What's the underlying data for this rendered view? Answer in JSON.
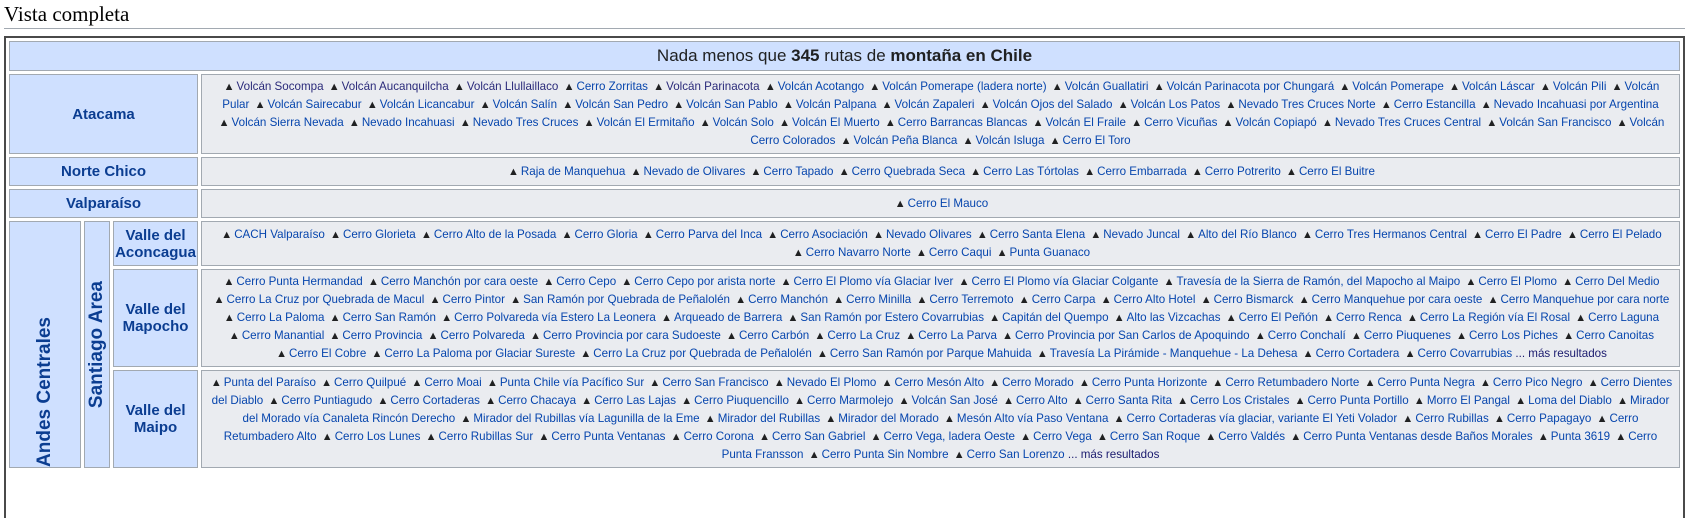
{
  "page": {
    "heading": "Vista completa"
  },
  "title": {
    "prefix": "Nada menos que ",
    "count": "345",
    "middle": " rutas de ",
    "bold": "montaña en Chile"
  },
  "marker": "▲",
  "more_label": "... más resultados",
  "atacama": {
    "label": "Atacama",
    "routes": [
      {
        "t": "Volcán Socompa",
        "v": true
      },
      {
        "t": "Volcán Aucanquilcha",
        "v": true
      },
      {
        "t": "Volcán Llullaillaco",
        "v": true
      },
      {
        "t": "Cerro Zorritas"
      },
      {
        "t": "Volcán Parinacota",
        "v": true
      },
      {
        "t": "Volcán Acotango"
      },
      {
        "t": "Volcán Pomerape (ladera norte)"
      },
      {
        "t": "Volcán Guallatiri"
      },
      {
        "t": "Volcán Parinacota por Chungará"
      },
      {
        "t": "Volcán Pomerape"
      },
      {
        "t": "Volcán Láscar"
      },
      {
        "t": "Volcán Pili"
      },
      {
        "t": "Volcán Pular"
      },
      {
        "t": "Volcán Sairecabur"
      },
      {
        "t": "Volcán Licancabur"
      },
      {
        "t": "Volcán Salín"
      },
      {
        "t": "Volcán San Pedro"
      },
      {
        "t": "Volcán San Pablo"
      },
      {
        "t": "Volcán Palpana"
      },
      {
        "t": "Volcán Zapaleri"
      },
      {
        "t": "Volcán Ojos del Salado"
      },
      {
        "t": "Volcán Los Patos"
      },
      {
        "t": "Nevado Tres Cruces Norte"
      },
      {
        "t": "Cerro Estancilla"
      },
      {
        "t": "Nevado Incahuasi por Argentina"
      },
      {
        "t": "Volcán Sierra Nevada"
      },
      {
        "t": "Nevado Incahuasi"
      },
      {
        "t": "Nevado Tres Cruces"
      },
      {
        "t": "Volcán El Ermitaño"
      },
      {
        "t": "Volcán Solo"
      },
      {
        "t": "Volcán El Muerto"
      },
      {
        "t": "Cerro Barrancas Blancas"
      },
      {
        "t": "Volcán El Fraile"
      },
      {
        "t": "Cerro Vicuñas"
      },
      {
        "t": "Volcán Copiapó"
      },
      {
        "t": "Nevado Tres Cruces Central"
      },
      {
        "t": "Volcán San Francisco"
      },
      {
        "t": "Volcán Cerro Colorados"
      },
      {
        "t": "Volcán Peña Blanca"
      },
      {
        "t": "Volcán Isluga"
      },
      {
        "t": "Cerro El Toro"
      }
    ]
  },
  "norte_chico": {
    "label": "Norte Chico",
    "routes": [
      {
        "t": "Raja de Manquehua"
      },
      {
        "t": "Nevado de Olivares"
      },
      {
        "t": "Cerro Tapado"
      },
      {
        "t": "Cerro Quebrada Seca"
      },
      {
        "t": "Cerro Las Tórtolas"
      },
      {
        "t": "Cerro Embarrada"
      },
      {
        "t": "Cerro Potrerito"
      },
      {
        "t": "Cerro El Buitre"
      }
    ]
  },
  "valparaiso": {
    "label": "Valparaíso",
    "routes": [
      {
        "t": "Cerro El Mauco"
      }
    ]
  },
  "central": {
    "label": "Andes Centrales",
    "santiago": {
      "label": "Santiago Area",
      "aconcagua": {
        "label": "Valle del Aconcagua",
        "routes": [
          {
            "t": "CACH Valparaíso"
          },
          {
            "t": "Cerro Glorieta"
          },
          {
            "t": "Cerro Alto de la Posada"
          },
          {
            "t": "Cerro Gloria"
          },
          {
            "t": "Cerro Parva del Inca"
          },
          {
            "t": "Cerro Asociación"
          },
          {
            "t": "Nevado Olivares"
          },
          {
            "t": "Cerro Santa Elena"
          },
          {
            "t": "Nevado Juncal"
          },
          {
            "t": "Alto del Río Blanco"
          },
          {
            "t": "Cerro Tres Hermanos Central"
          },
          {
            "t": "Cerro El Padre"
          },
          {
            "t": "Cerro El Pelado"
          },
          {
            "t": "Cerro Navarro Norte"
          },
          {
            "t": "Cerro Caqui"
          },
          {
            "t": "Punta Guanaco"
          }
        ]
      },
      "mapocho": {
        "label": "Valle del Mapocho",
        "routes": [
          {
            "t": "Cerro Punta Hermandad"
          },
          {
            "t": "Cerro Manchón por cara oeste"
          },
          {
            "t": "Cerro Cepo"
          },
          {
            "t": "Cerro Cepo por arista norte"
          },
          {
            "t": "Cerro El Plomo vía Glaciar Iver"
          },
          {
            "t": "Cerro El Plomo vía Glaciar Colgante"
          },
          {
            "t": "Travesía de la Sierra de Ramón, del Mapocho al Maipo"
          },
          {
            "t": "Cerro El Plomo"
          },
          {
            "t": "Cerro Del Medio"
          },
          {
            "t": "Cerro La Cruz por Quebrada de Macul"
          },
          {
            "t": "Cerro Pintor"
          },
          {
            "t": "San Ramón por Quebrada de Peñalolén"
          },
          {
            "t": "Cerro Manchón"
          },
          {
            "t": "Cerro Minilla"
          },
          {
            "t": "Cerro Terremoto"
          },
          {
            "t": "Cerro Carpa"
          },
          {
            "t": "Cerro Alto Hotel"
          },
          {
            "t": "Cerro Bismarck"
          },
          {
            "t": "Cerro Manquehue por cara oeste"
          },
          {
            "t": "Cerro Manquehue por cara norte"
          },
          {
            "t": "Cerro La Paloma"
          },
          {
            "t": "Cerro San Ramón"
          },
          {
            "t": "Cerro Polvareda vía Estero La Leonera"
          },
          {
            "t": "Arqueado de Barrera"
          },
          {
            "t": "San Ramón por Estero Covarrubias"
          },
          {
            "t": "Capitán del Quempo"
          },
          {
            "t": "Alto las Vizcachas"
          },
          {
            "t": "Cerro El Peñón"
          },
          {
            "t": "Cerro Renca"
          },
          {
            "t": "Cerro La Región vía El Rosal"
          },
          {
            "t": "Cerro Laguna"
          },
          {
            "t": "Cerro Manantial"
          },
          {
            "t": "Cerro Provincia"
          },
          {
            "t": "Cerro Polvareda"
          },
          {
            "t": "Cerro Provincia por cara Sudoeste"
          },
          {
            "t": "Cerro Carbón"
          },
          {
            "t": "Cerro La Cruz"
          },
          {
            "t": "Cerro La Parva"
          },
          {
            "t": "Cerro Provincia por San Carlos de Apoquindo"
          },
          {
            "t": "Cerro Conchalí"
          },
          {
            "t": "Cerro Piuquenes"
          },
          {
            "t": "Cerro Los Piches"
          },
          {
            "t": "Cerro Canoitas"
          },
          {
            "t": "Cerro El Cobre"
          },
          {
            "t": "Cerro La Paloma por Glaciar Sureste"
          },
          {
            "t": "Cerro La Cruz por Quebrada de Peñalolén"
          },
          {
            "t": "Cerro San Ramón por Parque Mahuida"
          },
          {
            "t": "Travesía La Pirámide - Manquehue - La Dehesa"
          },
          {
            "t": "Cerro Cortadera"
          },
          {
            "t": "Cerro Covarrubias"
          }
        ],
        "more": true
      },
      "maipo": {
        "label": "Valle del Maipo",
        "routes": [
          {
            "t": "Punta del Paraíso"
          },
          {
            "t": "Cerro Quilpué"
          },
          {
            "t": "Cerro Moai"
          },
          {
            "t": "Punta Chile vía Pacífico Sur"
          },
          {
            "t": "Cerro San Francisco"
          },
          {
            "t": "Nevado El Plomo"
          },
          {
            "t": "Cerro Mesón Alto"
          },
          {
            "t": "Cerro Morado"
          },
          {
            "t": "Cerro Punta Horizonte"
          },
          {
            "t": "Cerro Retumbadero Norte"
          },
          {
            "t": "Cerro Punta Negra"
          },
          {
            "t": "Cerro Pico Negro"
          },
          {
            "t": "Cerro Dientes del Diablo"
          },
          {
            "t": "Cerro Puntiagudo"
          },
          {
            "t": "Cerro Cortaderas"
          },
          {
            "t": "Cerro Chacaya"
          },
          {
            "t": "Cerro Las Lajas"
          },
          {
            "t": "Cerro Piuquencillo"
          },
          {
            "t": "Cerro Marmolejo"
          },
          {
            "t": "Volcán San José"
          },
          {
            "t": "Cerro Alto"
          },
          {
            "t": "Cerro Santa Rita"
          },
          {
            "t": "Cerro Los Cristales"
          },
          {
            "t": "Cerro Punta Portillo"
          },
          {
            "t": "Morro El Pangal"
          },
          {
            "t": "Loma del Diablo"
          },
          {
            "t": "Mirador del Morado vía Canaleta Rincón Derecho"
          },
          {
            "t": "Mirador del Rubillas vía Lagunilla de la Eme"
          },
          {
            "t": "Mirador del Rubillas"
          },
          {
            "t": "Mirador del Morado"
          },
          {
            "t": "Mesón Alto vía Paso Ventana"
          },
          {
            "t": "Cerro Cortaderas vía glaciar, variante El Yeti Volador"
          },
          {
            "t": "Cerro Rubillas"
          },
          {
            "t": "Cerro Papagayo"
          },
          {
            "t": "Cerro Retumbadero Alto"
          },
          {
            "t": "Cerro Los Lunes"
          },
          {
            "t": "Cerro Rubillas Sur"
          },
          {
            "t": "Cerro Punta Ventanas"
          },
          {
            "t": "Cerro Corona"
          },
          {
            "t": "Cerro San Gabriel"
          },
          {
            "t": "Cerro Vega, ladera Oeste"
          },
          {
            "t": "Cerro Vega"
          },
          {
            "t": "Cerro San Roque"
          },
          {
            "t": "Cerro Valdés"
          },
          {
            "t": "Cerro Punta Ventanas desde Baños Morales"
          },
          {
            "t": "Punta 3619"
          },
          {
            "t": "Cerro Punta Fransson"
          },
          {
            "t": "Cerro Punta Sin Nombre"
          },
          {
            "t": "Cerro San Lorenzo"
          }
        ],
        "more": true
      }
    }
  }
}
